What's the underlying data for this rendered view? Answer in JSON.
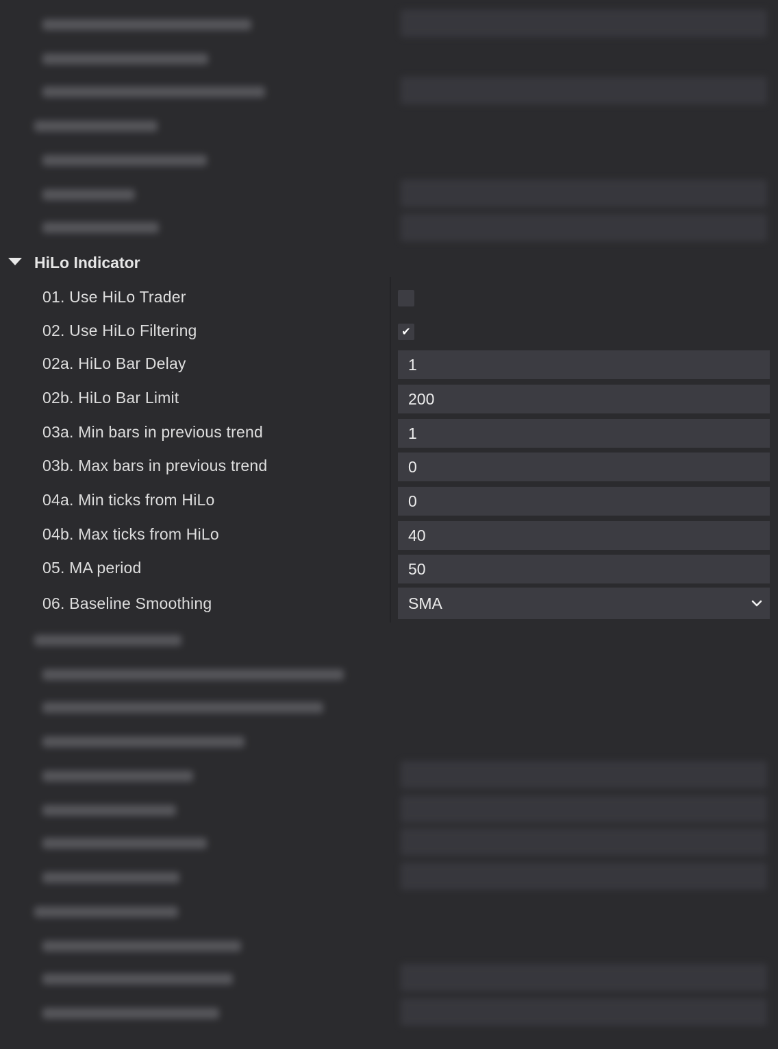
{
  "section": {
    "title": "HiLo Indicator",
    "expanded": true
  },
  "properties": [
    {
      "label": "01. Use HiLo Trader",
      "type": "checkbox",
      "checked": false
    },
    {
      "label": "02. Use HiLo Filtering",
      "type": "checkbox",
      "checked": true,
      "mark": "✔"
    },
    {
      "label": "02a. HiLo Bar Delay",
      "type": "number",
      "value": "1"
    },
    {
      "label": "02b. HiLo Bar Limit",
      "type": "number",
      "value": "200"
    },
    {
      "label": "03a. Min bars in previous trend",
      "type": "number",
      "value": "1"
    },
    {
      "label": "03b. Max bars in previous trend",
      "type": "number",
      "value": "0"
    },
    {
      "label": "04a. Min ticks from HiLo",
      "type": "number",
      "value": "0"
    },
    {
      "label": "04b. Max ticks from HiLo",
      "type": "number",
      "value": "40"
    },
    {
      "label": "05. MA period",
      "type": "number",
      "value": "50"
    },
    {
      "label": "06. Baseline Smoothing",
      "type": "select",
      "value": "SMA"
    }
  ],
  "colors": {
    "background": "#2b2b2e",
    "field": "#3c3c42",
    "text": "#dedede"
  }
}
